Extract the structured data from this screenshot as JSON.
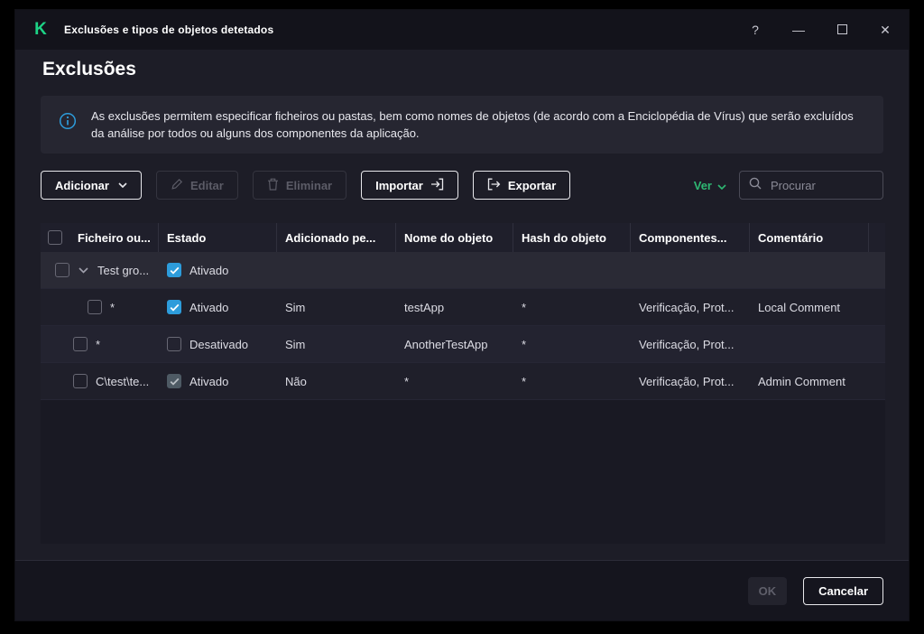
{
  "window": {
    "title": "Exclusões e tipos de objetos detetados",
    "controls": {
      "help": "?",
      "minimize": "—",
      "close": "✕"
    }
  },
  "page": {
    "title": "Exclusões",
    "info_text": "As exclusões permitem especificar ficheiros ou pastas, bem como nomes de objetos (de acordo com a Enciclopédia de Vírus) que serão excluídos da análise por todos ou alguns dos componentes da aplicação."
  },
  "toolbar": {
    "add_label": "Adicionar",
    "edit_label": "Editar",
    "delete_label": "Eliminar",
    "import_label": "Importar",
    "export_label": "Exportar",
    "view_label": "Ver",
    "search_placeholder": "Procurar"
  },
  "table": {
    "columns": [
      "Ficheiro ou...",
      "Estado",
      "Adicionado pe...",
      "Nome do objeto",
      "Hash do objeto",
      "Componentes...",
      "Comentário"
    ],
    "rows": [
      {
        "file": "Test gro...",
        "estado": "Ativado",
        "estado_checked": true,
        "adicionado": "",
        "nome": "",
        "hash": "",
        "componentes": "",
        "comentario": ""
      },
      {
        "file": "*",
        "estado": "Ativado",
        "estado_checked": true,
        "adicionado": "Sim",
        "nome": "testApp",
        "hash": "*",
        "componentes": "Verificação, Prot...",
        "comentario": "Local Comment"
      },
      {
        "file": "*",
        "estado": "Desativado",
        "estado_checked": false,
        "adicionado": "Sim",
        "nome": "AnotherTestApp",
        "hash": "*",
        "componentes": "Verificação, Prot...",
        "comentario": ""
      },
      {
        "file": "C\\test\\te...",
        "estado": "Ativado",
        "estado_checked": true,
        "estado_disabled": true,
        "adicionado": "Não",
        "nome": "*",
        "hash": "*",
        "componentes": "Verificação, Prot...",
        "comentario": "Admin Comment"
      }
    ]
  },
  "footer": {
    "ok_label": "OK",
    "cancel_label": "Cancelar"
  },
  "colors": {
    "accent_blue": "#2d9cdb",
    "accent_green": "#2eb873",
    "logo_green": "#1dd386"
  }
}
